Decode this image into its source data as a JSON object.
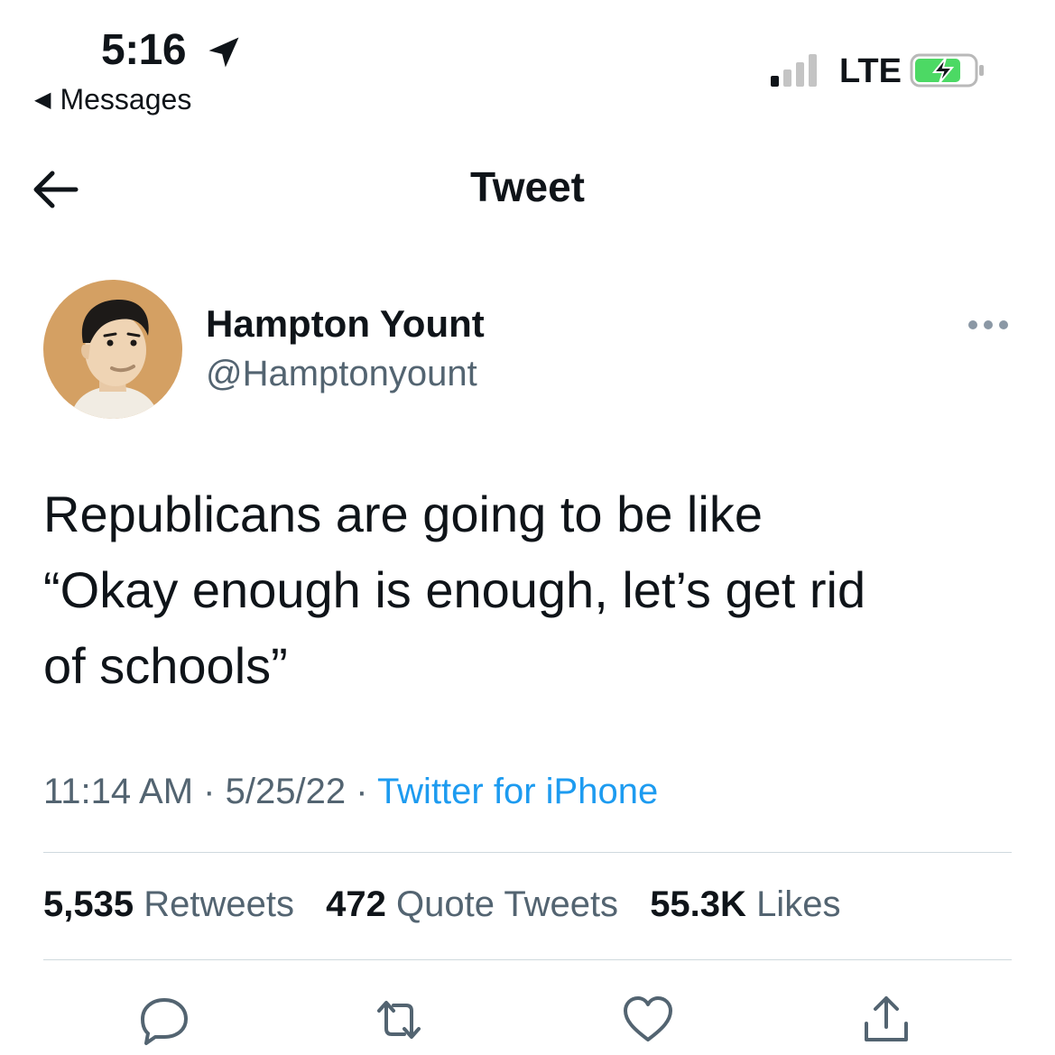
{
  "status_bar": {
    "time": "5:16",
    "back_app_label": "Messages",
    "network": "LTE",
    "icons": [
      "location-arrow-icon",
      "signal-bars-icon",
      "battery-charging-icon"
    ]
  },
  "header": {
    "title": "Tweet",
    "back_icon": "back-arrow-icon"
  },
  "author": {
    "name": "Hampton Yount",
    "handle": "@Hamptonyount",
    "more_icon": "more-options-icon"
  },
  "tweet": {
    "text": "Republicans are going to be like\n“Okay enough is enough, let’s get rid\nof schools”",
    "time": "11:14 AM",
    "separator": "·",
    "date": "5/25/22",
    "source": "Twitter for iPhone"
  },
  "stats": {
    "retweets_count": "5,535",
    "retweets_label": "Retweets",
    "quotes_count": "472",
    "quotes_label": "Quote Tweets",
    "likes_count": "55.3K",
    "likes_label": "Likes"
  },
  "actions": [
    "reply-icon",
    "retweet-icon",
    "like-icon",
    "share-icon"
  ],
  "colors": {
    "text": "#0f1419",
    "secondary": "#536471",
    "link": "#1d9bf0",
    "battery": "#4cd964",
    "divider": "#cfd9de"
  }
}
